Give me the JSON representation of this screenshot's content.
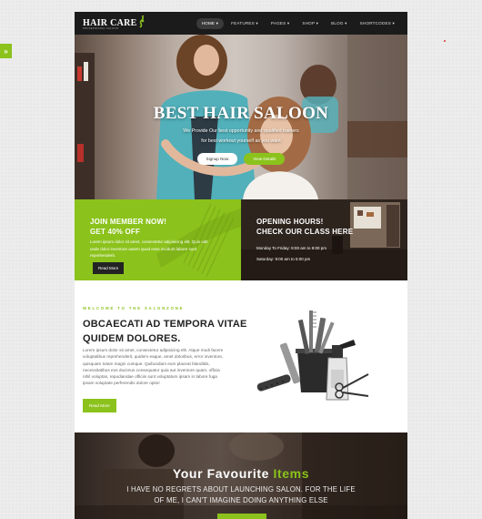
{
  "side_tab": {
    "label": "»"
  },
  "nav": {
    "logo": {
      "text": "HAIR CARE",
      "tagline": "PROFESSIONAL SALOON"
    },
    "menu": [
      {
        "label": "HOME ▾"
      },
      {
        "label": "FEATURES ▾"
      },
      {
        "label": "PAGES ▾"
      },
      {
        "label": "SHOP ▾"
      },
      {
        "label": "BLOG ▾"
      },
      {
        "label": "SHORTCODES ▾"
      }
    ]
  },
  "hero": {
    "title": "BEST HAIR SALOON",
    "subtitle_line1": "We Provide Our best opportunity and qualified trainers",
    "subtitle_line2": "for best workout yourself as you want",
    "signup_label": "Signup Now",
    "details_label": "View Details"
  },
  "promo_join": {
    "title_line1": "JOIN MEMBER NOW!",
    "title_line2": "GET 40% OFF",
    "text_line1": "Lorem ipsum dolor sit amet, consectetur adipisicing elit. Quis odit",
    "text_line2": "unde dolor inventore autem quod esse incidunt labore sunt",
    "text_line3": "reprehenderit.",
    "button_label": "Read More"
  },
  "promo_hours": {
    "title_line1": "OPENING HOURS!",
    "title_line2": "CHECK OUR CLASS HERE",
    "weekday": "Monday To Friday: 9:00 am to 9:00 pm",
    "saturday": "Saturday: 9:00 am to 5:00 pm"
  },
  "welcome": {
    "kicker": "WELCOME TO THE SALONZONE",
    "title_line1": "OBCAECATI AD TEMPORA VITAE",
    "title_line2": "QUIDEM DOLORES.",
    "text_lines": [
      "Lorem ipsum dolor sit amet, consectetur adipisicing elit. Atque modi facere",
      "voluptatibus reprehenderit, quidem eaque, amet doloribus, error inventore,",
      "quisquam totam magni cumque. Quibusdam eum placeat blanditiis,",
      "necessitatibus eos ducimus consequatur quia aut inventore quam, officia",
      "nihil voluptas, repudiandae officiis sunt voluptatum ipsam in labore fuga",
      "ipsam voluptate perferendis dolore optio!"
    ],
    "button_label": "Read More"
  },
  "favourite": {
    "title_main": "Your Favourite",
    "title_accent": "Items",
    "text_line1": "I HAVE NO REGRETS ABOUT LAUNCHING SALON. FOR THE LIFE",
    "text_line2": "OF ME, I CAN'T IMAGINE DOING ANYTHING ELSE"
  },
  "colors": {
    "accent": "#8bc21c",
    "nav_bg": "#1b1b1b",
    "dark_button": "#232323"
  }
}
